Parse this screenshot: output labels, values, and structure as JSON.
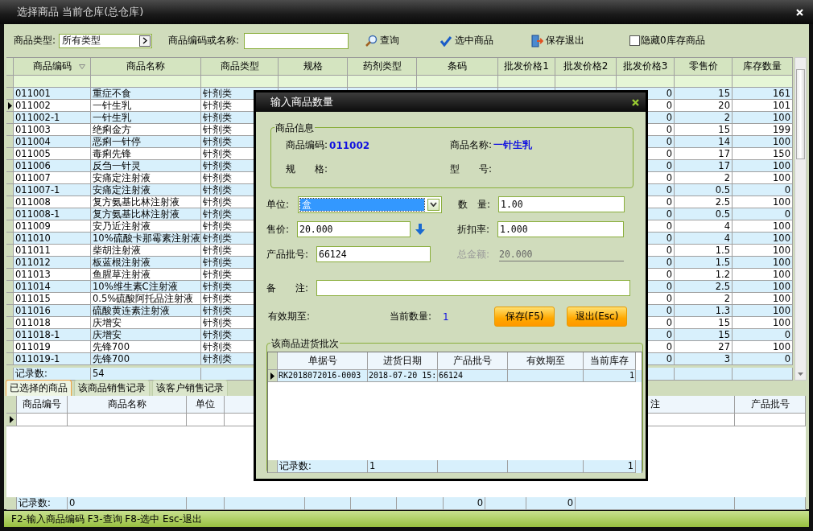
{
  "window": {
    "title": "选择商品 当前仓库(总仓库)"
  },
  "toolbar": {
    "type_label": "商品类型:",
    "type_value": "所有类型",
    "search_label": "商品编码或名称:",
    "buttons": [
      {
        "kind": "search",
        "label": "查询"
      },
      {
        "kind": "check",
        "label": "选中商品"
      },
      {
        "kind": "exit",
        "label": "保存退出"
      }
    ],
    "hide_zero": {
      "label": "隐藏0库存商品",
      "checked": false
    }
  },
  "goods_table": {
    "columns": [
      "商品编码",
      "商品名称",
      "商品类型",
      "规格",
      "药剂类型",
      "条码",
      "批发价格1",
      "批发价格2",
      "批发价格3",
      "零售价",
      "库存数量"
    ],
    "rows": [
      {
        "selected": false,
        "code": "011001",
        "name": "重症不食",
        "type": "针剂类",
        "price3": "0",
        "retail": "15",
        "stock": "161"
      },
      {
        "selected": true,
        "code": "011002",
        "name": "一针生乳",
        "type": "针剂类",
        "price3": "0",
        "retail": "20",
        "stock": "101"
      },
      {
        "selected": false,
        "code": "011002-1",
        "name": "一针生乳",
        "type": "针剂类",
        "price3": "0",
        "retail": "2",
        "stock": "100"
      },
      {
        "selected": false,
        "code": "011003",
        "name": "绝痢金方",
        "type": "针剂类",
        "price3": "0",
        "retail": "15",
        "stock": "199"
      },
      {
        "selected": false,
        "code": "011004",
        "name": "恶痢一针停",
        "type": "针剂类",
        "price3": "0",
        "retail": "14",
        "stock": "100"
      },
      {
        "selected": false,
        "code": "011005",
        "name": "毒痢先锋",
        "type": "针剂类",
        "price3": "0",
        "retail": "17",
        "stock": "150"
      },
      {
        "selected": false,
        "code": "011006",
        "name": "反刍一针灵",
        "type": "针剂类",
        "price3": "0",
        "retail": "17",
        "stock": "100"
      },
      {
        "selected": false,
        "code": "011007",
        "name": "安痛定注射液",
        "type": "针剂类",
        "price3": "0",
        "retail": "2",
        "stock": "100"
      },
      {
        "selected": false,
        "code": "011007-1",
        "name": "安痛定注射液",
        "type": "针剂类",
        "price3": "0",
        "retail": "0.5",
        "stock": "0"
      },
      {
        "selected": false,
        "code": "011008",
        "name": "复方氨基比林注射液",
        "type": "针剂类",
        "price3": "0",
        "retail": "2.5",
        "stock": "100"
      },
      {
        "selected": false,
        "code": "011008-1",
        "name": "复方氨基比林注射液",
        "type": "针剂类",
        "price3": "0",
        "retail": "0.5",
        "stock": "0"
      },
      {
        "selected": false,
        "code": "011009",
        "name": "安乃近注射液",
        "type": "针剂类",
        "price3": "0",
        "retail": "4",
        "stock": "100"
      },
      {
        "selected": false,
        "code": "011010",
        "name": "10%硫酸卡那霉素注射液",
        "type": "针剂类",
        "price3": "0",
        "retail": "4",
        "stock": "100"
      },
      {
        "selected": false,
        "code": "011011",
        "name": "柴胡注射液",
        "type": "针剂类",
        "price3": "0",
        "retail": "1.5",
        "stock": "100"
      },
      {
        "selected": false,
        "code": "011012",
        "name": "板蓝根注射液",
        "type": "针剂类",
        "price3": "0",
        "retail": "1.5",
        "stock": "100"
      },
      {
        "selected": false,
        "code": "011013",
        "name": "鱼腥草注射液",
        "type": "针剂类",
        "price3": "0",
        "retail": "1.2",
        "stock": "100"
      },
      {
        "selected": false,
        "code": "011014",
        "name": "10%维生素C注射液",
        "type": "针剂类",
        "price3": "0",
        "retail": "2.5",
        "stock": "100"
      },
      {
        "selected": false,
        "code": "011015",
        "name": "0.5%硫酸阿托品注射液",
        "type": "针剂类",
        "price3": "0",
        "retail": "2",
        "stock": "100"
      },
      {
        "selected": false,
        "code": "011016",
        "name": "硫酸黄连素注射液",
        "type": "针剂类",
        "price3": "0",
        "retail": "1.3",
        "stock": "100"
      },
      {
        "selected": false,
        "code": "011018",
        "name": "庆增安",
        "type": "针剂类",
        "price3": "0",
        "retail": "15",
        "stock": "100"
      },
      {
        "selected": false,
        "code": "011018-1",
        "name": "庆增安",
        "type": "针剂类",
        "price3": "0",
        "retail": "15",
        "stock": "0"
      },
      {
        "selected": false,
        "code": "011019",
        "name": "先锋700",
        "type": "针剂类",
        "price3": "0",
        "retail": "27",
        "stock": "100"
      },
      {
        "selected": false,
        "code": "011019-1",
        "name": "先锋700",
        "type": "针剂类",
        "price3": "0",
        "retail": "3",
        "stock": "0"
      }
    ],
    "footer": {
      "label": "记录数:",
      "count": "54"
    }
  },
  "tabs": [
    {
      "label": "已选择的商品",
      "selected": true
    },
    {
      "label": "该商品销售记录",
      "selected": false
    },
    {
      "label": "该客户销售记录",
      "selected": false
    }
  ],
  "selected_table": {
    "columns_left": [
      "商品编号",
      "商品名称",
      "单位"
    ],
    "columns_right": [
      "注",
      "产品批号"
    ],
    "rows": [
      {
        "selected": true
      }
    ],
    "footer": {
      "label": "记录数:",
      "count": "0",
      "totals": [
        "0",
        "0"
      ]
    }
  },
  "dialog": {
    "title": "输入商品数量",
    "info": {
      "legend": "商品信息",
      "fields": [
        {
          "label": "商品编码:",
          "value": "011002"
        },
        {
          "label": "商品名称:",
          "value": "一针生乳"
        },
        {
          "label": "规　　格:"
        },
        {
          "label": "型　　号:"
        }
      ]
    },
    "unit": {
      "label": "单位:",
      "value": "盒"
    },
    "quantity": {
      "label": "数　量:",
      "value": "1.00"
    },
    "price": {
      "label": "售价:",
      "value": "20.000"
    },
    "discount": {
      "label": "折扣率:",
      "value": "1.000"
    },
    "batch_no": {
      "label": "产品批号:",
      "value": "66124"
    },
    "total": {
      "label": "总金额:",
      "value": "20.000",
      "disabled": true
    },
    "note": {
      "label": "备　　注:"
    },
    "expiry": {
      "label": "有效期至:"
    },
    "current_qty": {
      "label": "当前数量:",
      "value": "1"
    },
    "buttons": [
      "保存(F5)",
      "退出(Esc)"
    ],
    "batches": {
      "legend": "该商品进货批次",
      "columns": [
        "单据号",
        "进货日期",
        "产品批号",
        "有效期至",
        "当前库存"
      ],
      "rows": [
        {
          "selected": true,
          "doc_no": "RK2018072016-0003",
          "date": "2018-07-20 15:",
          "batch": "66124",
          "stock": "1"
        }
      ],
      "footer": {
        "label": "记录数:",
        "count": "1",
        "stock_total": "1"
      }
    }
  },
  "status_bar": "F2-输入商品编码 F3-查询 F8-选中 Esc-退出"
}
